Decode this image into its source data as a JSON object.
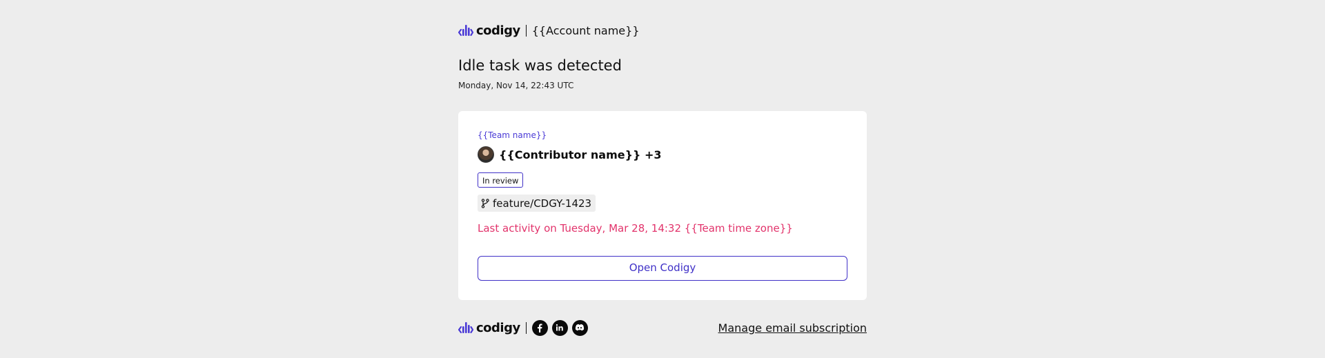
{
  "header": {
    "logo_text": "codigy",
    "account_name": "{{Account name}}"
  },
  "notification": {
    "title": "Idle task was detected",
    "date": "Monday, Nov 14, 22:43 UTC"
  },
  "card": {
    "team_name": "{{Team name}}",
    "contributor": "{{Contributor name}} +3",
    "status_badge": "In review",
    "branch": "feature/CDGY-1423",
    "last_activity": "Last activity on Tuesday, Mar 28, 14:32 {{Team time zone}}",
    "button_label": "Open Codigy"
  },
  "footer": {
    "logo_text": "codigy",
    "social_icons": [
      "facebook-icon",
      "linkedin-icon",
      "discord-icon"
    ],
    "manage_link": "Manage email subscription"
  },
  "colors": {
    "background": "#ededed",
    "brand_accent": "#3f30c7",
    "alert_text": "#e2336b",
    "card": "#ffffff"
  }
}
